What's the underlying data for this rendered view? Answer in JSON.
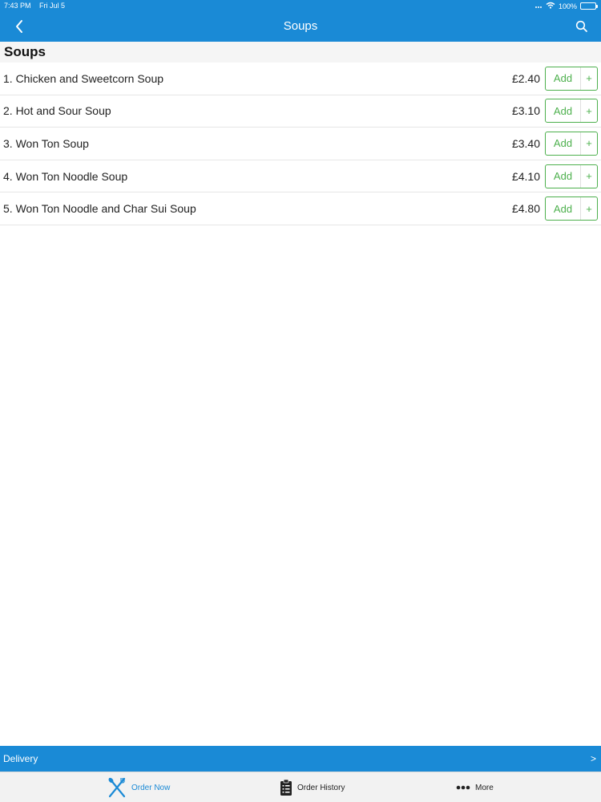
{
  "status_bar": {
    "time": "7:43 PM",
    "date": "Fri Jul 5",
    "battery": "100%",
    "battery_level": 1.0,
    "icons": [
      "wifi-icon",
      "signal-icon",
      "battery-icon"
    ]
  },
  "nav": {
    "title": "Soups",
    "back_icon": "chevron-left-icon",
    "search_icon": "search-icon"
  },
  "section": {
    "title": "Soups"
  },
  "items": [
    {
      "name": "1. Chicken and Sweetcorn Soup",
      "price": "£2.40",
      "add_label": "Add",
      "plus": "+"
    },
    {
      "name": "2. Hot and Sour Soup",
      "price": "£3.10",
      "add_label": "Add",
      "plus": "+"
    },
    {
      "name": "3. Won Ton Soup",
      "price": "£3.40",
      "add_label": "Add",
      "plus": "+"
    },
    {
      "name": "4. Won Ton Noodle Soup",
      "price": "£4.10",
      "add_label": "Add",
      "plus": "+"
    },
    {
      "name": "5. Won Ton Noodle and Char Sui Soup",
      "price": "£4.80",
      "add_label": "Add",
      "plus": "+"
    }
  ],
  "delivery": {
    "label": "Delivery",
    "arrow": ">"
  },
  "tabs": [
    {
      "label": "Order Now",
      "icon": "fork-knife-icon",
      "active": true
    },
    {
      "label": "Order History",
      "icon": "clipboard-icon",
      "active": false
    },
    {
      "label": "More",
      "icon": "more-dots-icon",
      "active": false
    }
  ],
  "colors": {
    "brand": "#1a8ad6",
    "add_green": "#4db04d",
    "section_bg": "#f5f5f5"
  }
}
